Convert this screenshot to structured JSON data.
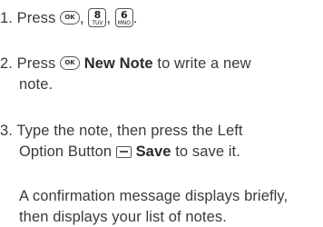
{
  "steps": [
    {
      "num": "1.",
      "text_press": "Press",
      "keys": [
        {
          "icon": "ok-key-icon",
          "label": "OK"
        },
        {
          "icon": "key-8-icon",
          "big": "8",
          "small": "TUV"
        },
        {
          "icon": "key-6-icon",
          "big": "6",
          "small": "MNO"
        }
      ],
      "sep": ","
    },
    {
      "num": "2.",
      "text_press": "Press",
      "ok_label": "OK",
      "bold": "New Note",
      "rest_line1": "to write a new",
      "line2": "note."
    },
    {
      "num": "3.",
      "line1": "Type the note, then press the Left",
      "line2_pre": "Option Button",
      "bold": "Save",
      "line2_post": "to save it."
    }
  ],
  "note": {
    "line1": "A confirmation message displays briefly,",
    "line2": "then displays your list of notes."
  }
}
